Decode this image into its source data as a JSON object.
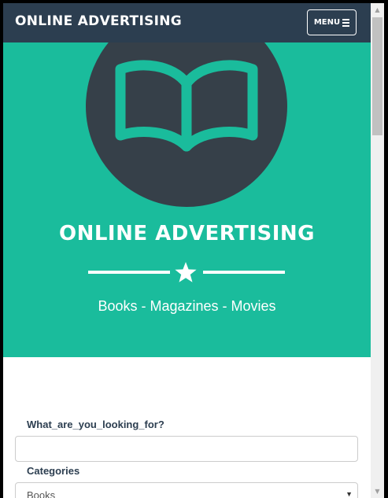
{
  "navbar": {
    "brand": "ONLINE ADVERTISING",
    "menu_label": "MENU",
    "menu_icon": "hamburger-icon"
  },
  "hero": {
    "icon": "open-book-icon",
    "title": "ONLINE ADVERTISING",
    "divider_icon": "star-icon",
    "subtitle": "Books - Magazines - Movies"
  },
  "form": {
    "search_label": "What_are_you_looking_for?",
    "search_value": "",
    "search_placeholder": "",
    "categories_label": "Categories",
    "category_selected": "Books"
  },
  "colors": {
    "navbar_bg": "#2c3e50",
    "hero_bg": "#1abc9c",
    "circle_bg": "#364049",
    "accent": "#1abc9c",
    "text_dark": "#2c3e50"
  }
}
